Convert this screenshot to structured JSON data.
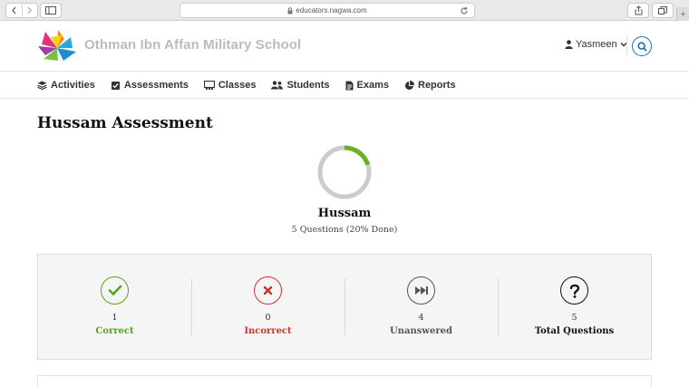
{
  "browser": {
    "url": "educators.nagwa.com"
  },
  "header": {
    "school_name": "Othman Ibn Affan Military School",
    "user_name": "Yasmeen"
  },
  "menu": [
    {
      "label": "Activities",
      "icon": "stack-icon"
    },
    {
      "label": "Assessments",
      "icon": "assessment-icon"
    },
    {
      "label": "Classes",
      "icon": "classes-icon"
    },
    {
      "label": "Students",
      "icon": "students-icon"
    },
    {
      "label": "Exams",
      "icon": "exam-icon"
    },
    {
      "label": "Reports",
      "icon": "pie-chart-icon"
    }
  ],
  "page": {
    "title": "Hussam Assessment",
    "student_name": "Hussam",
    "progress_text": "5 Questions (20% Done)",
    "progress_fraction": 0.2
  },
  "stats": [
    {
      "count": "1",
      "label": "Correct",
      "color": "#5aa31c",
      "icon": "check-circle-icon"
    },
    {
      "count": "0",
      "label": "Incorrect",
      "color": "#d0312d",
      "icon": "x-circle-icon"
    },
    {
      "count": "4",
      "label": "Unanswered",
      "color": "#555555",
      "icon": "skip-circle-icon"
    },
    {
      "count": "5",
      "label": "Total Questions",
      "color": "#111111",
      "icon": "question-circle-icon"
    }
  ],
  "colors": {
    "accent_blue": "#1a6fb3",
    "progress_green": "#6ab023",
    "ring_gray": "#cccccc"
  }
}
